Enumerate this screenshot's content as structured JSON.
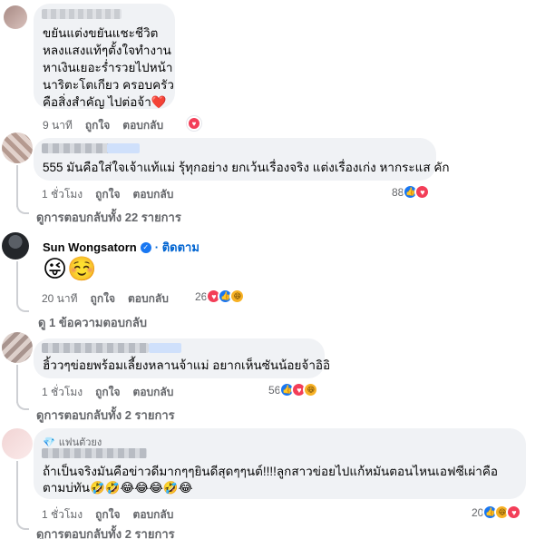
{
  "comments": [
    {
      "lines": [
        "ขยันแต่งขยันแชะชีวิต",
        "หลงแสงแท้ๆตั้งใจทำงาน",
        "หาเงินเยอะร่ำรวยไปหน้า",
        "นาริตะโตเกียว ครอบครัว",
        "คือสิ่งสำคัญ ไปต่อจ้า❤️"
      ],
      "time": "9 นาที",
      "like": "ถูกใจ",
      "reply": "ตอบกลับ"
    },
    {
      "text": "555 มันคือใส่ใจเจ้าแท้แม่ รุ้ทุกอย่าง ยกเว้นเรื่องจริง แต่งเรื่องเก่ง หากระแส คัก",
      "time": "1 ชั่วโมง",
      "like": "ถูกใจ",
      "reply": "ตอบกลับ",
      "reaction_count": "88",
      "view_replies": "ดูการตอบกลับทั้ง 22 รายการ"
    },
    {
      "name": "Sun Wongsatorn",
      "follow": "ติดตาม",
      "emojis": "😜☺️",
      "time": "20 นาที",
      "like": "ถูกใจ",
      "reply": "ตอบกลับ",
      "reaction_count": "26",
      "view_replies": "ดู 1 ข้อความตอบกลับ"
    },
    {
      "text": "ฮิ้ววๆข่อยพร้อมเลี้ยงหลานจ้าแม่ อยากเห็นซันน้อยจ้าอิอิ",
      "time": "1 ชั่วโมง",
      "like": "ถูกใจ",
      "reply": "ตอบกลับ",
      "reaction_count": "56",
      "view_replies": "ดูการตอบกลับทั้ง 2 รายการ"
    },
    {
      "badge": "แฟนตัวยง",
      "line1": "ถ้าเป็นจริงมันคือข่าวดีมากๆๆยินดีสุดๆๆนต์!!!!ลูกสาวข่อยไปแก้หมันตอนไหนเอฟซีเผ่าคือ",
      "line2": "ตามบ่ทัน🤣🤣😂😂😂🤣😂",
      "time": "1 ชั่วโมง",
      "like": "ถูกใจ",
      "reply": "ตอบกลับ",
      "reaction_count": "20",
      "view_replies": "ดูการตอบกลับทั้ง 2 รายการ"
    }
  ],
  "colors": {
    "like": "#1877f2",
    "love": "#f33e58",
    "haha": "#f7b125",
    "bubble": "#f0f2f5",
    "muted": "#65676b"
  }
}
